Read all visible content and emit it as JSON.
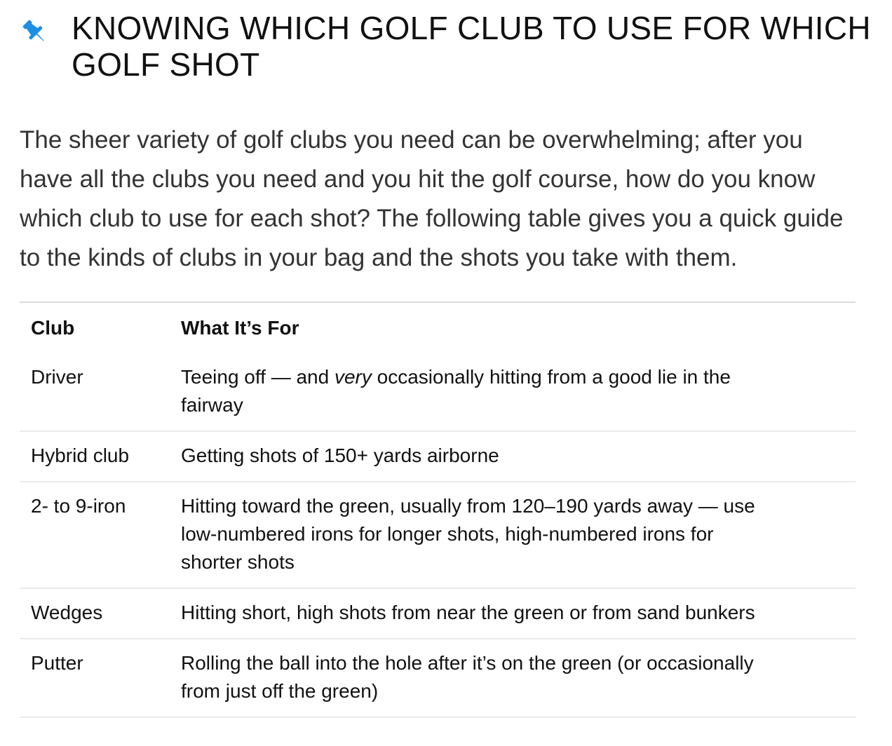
{
  "article": {
    "title": "KNOWING WHICH GOLF CLUB TO USE FOR WHICH GOLF SHOT",
    "icon": "pin-icon",
    "accent_color": "#1a8fe3",
    "intro": "The sheer variety of golf clubs you need can be overwhelming; after you have all the clubs you need and you hit the golf course, how do you know which club to use for each shot? The following table gives you a quick guide to the kinds of clubs in your bag and the shots you take with them."
  },
  "table": {
    "headers": {
      "club": "Club",
      "purpose": "What It’s For"
    },
    "rows": [
      {
        "club": "Driver",
        "purpose_before": "Teeing off — and ",
        "purpose_emphasis": "very",
        "purpose_after": " occasionally hitting from a good lie in the fairway"
      },
      {
        "club": "Hybrid club",
        "purpose": "Getting shots of 150+ yards airborne"
      },
      {
        "club": "2- to 9-iron",
        "purpose": "Hitting toward the green, usually from 120–190 yards away — use low-numbered irons for longer shots, high-numbered irons for shorter shots"
      },
      {
        "club": "Wedges",
        "purpose": "Hitting short, high shots from near the green or from sand bunkers"
      },
      {
        "club": "Putter",
        "purpose": "Rolling the ball into the hole after it’s on the green (or occasionally from just off the green)"
      }
    ]
  }
}
